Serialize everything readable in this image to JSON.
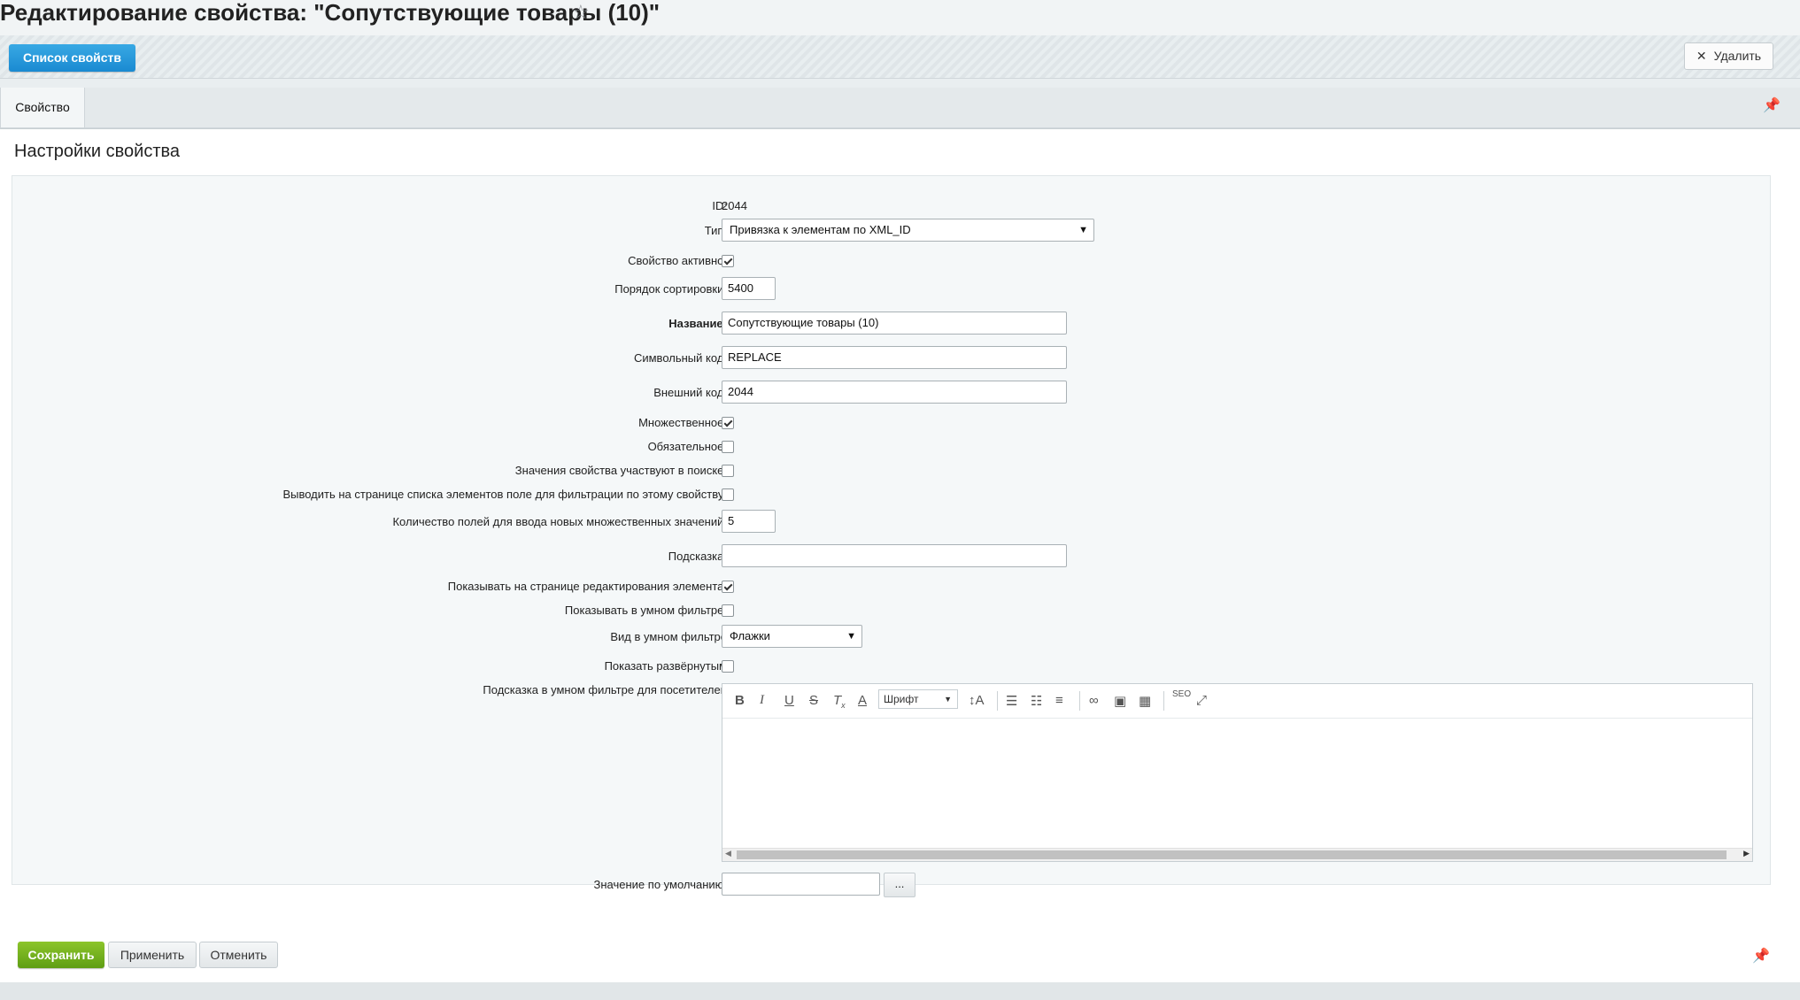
{
  "page": {
    "title": "Редактирование свойства: \"Сопутствующие товары (10)\""
  },
  "toolbar": {
    "list_button": "Список свойств",
    "delete_button": "Удалить"
  },
  "tabs": [
    {
      "label": "Свойство"
    }
  ],
  "section": {
    "title": "Настройки свойства"
  },
  "form": {
    "id_label": "ID:",
    "id_value": "2044",
    "type_label": "Тип:",
    "type_value": "Привязка к элементам по XML_ID",
    "active_label": "Свойство активно:",
    "active_checked": true,
    "sort_label": "Порядок сортировки:",
    "sort_value": "5400",
    "name_label": "Название:",
    "name_value": "Сопутствующие товары (10)",
    "code_label": "Символьный код:",
    "code_value": "REPLACE",
    "xml_label": "Внешний код:",
    "xml_value": "2044",
    "multiple_label": "Множественное:",
    "multiple_checked": true,
    "required_label": "Обязательное:",
    "required_checked": false,
    "search_label": "Значения свойства участвуют в поиске:",
    "search_checked": false,
    "filter_label": "Выводить на странице списка элементов поле для фильтрации по этому свойству:",
    "filter_checked": false,
    "multi_count_label": "Количество полей для ввода новых множественных значений:",
    "multi_count_value": "5",
    "hint_label": "Подсказка:",
    "hint_value": "",
    "show_edit_label": "Показывать на странице редактирования элемента:",
    "show_edit_checked": true,
    "smart_filter_label": "Показывать в умном фильтре:",
    "smart_filter_checked": false,
    "smart_view_label": "Вид в умном фильтре",
    "smart_view_value": "Флажки",
    "expanded_label": "Показать развёрнутым",
    "expanded_checked": false,
    "smart_hint_label": "Подсказка в умном фильтре для посетителей",
    "default_label": "Значение по умолчанию:",
    "default_value": "",
    "default_button": "..."
  },
  "editor": {
    "font_select": "Шрифт",
    "seo_label": "SEO"
  },
  "footer": {
    "save": "Сохранить",
    "apply": "Применить",
    "cancel": "Отменить"
  }
}
